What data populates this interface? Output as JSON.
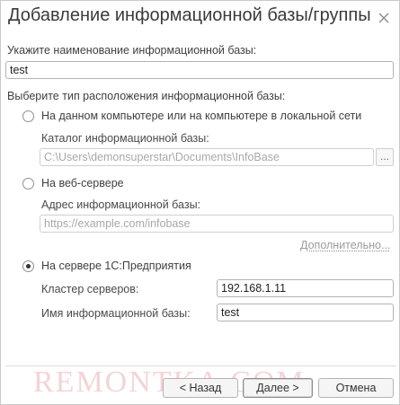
{
  "window": {
    "title": "Добавление информационной базы/группы"
  },
  "name_field": {
    "label": "Укажите наименование информационной базы:",
    "value": "test"
  },
  "location": {
    "label": "Выберите тип расположения информационной базы:",
    "local": {
      "label": "На данном компьютере или на компьютере в локальной сети",
      "selected": false,
      "catalog_label": "Каталог информационной базы:",
      "catalog_value": "C:\\Users\\demonsuperstar\\Documents\\InfoBase",
      "browse_label": "..."
    },
    "web": {
      "label": "На веб-сервере",
      "selected": false,
      "address_label": "Адрес информационной базы:",
      "address_placeholder": "https://example.com/infobase",
      "more_link": "Дополнительно..."
    },
    "server": {
      "label": "На сервере 1С:Предприятия",
      "selected": true,
      "cluster_label": "Кластер серверов:",
      "cluster_value": "192.168.1.11",
      "db_name_label": "Имя информационной базы:",
      "db_name_value": "test"
    }
  },
  "buttons": {
    "back": "< Назад",
    "next": "Далее >",
    "cancel": "Отмена"
  },
  "watermark": "REMONTKA.COM"
}
